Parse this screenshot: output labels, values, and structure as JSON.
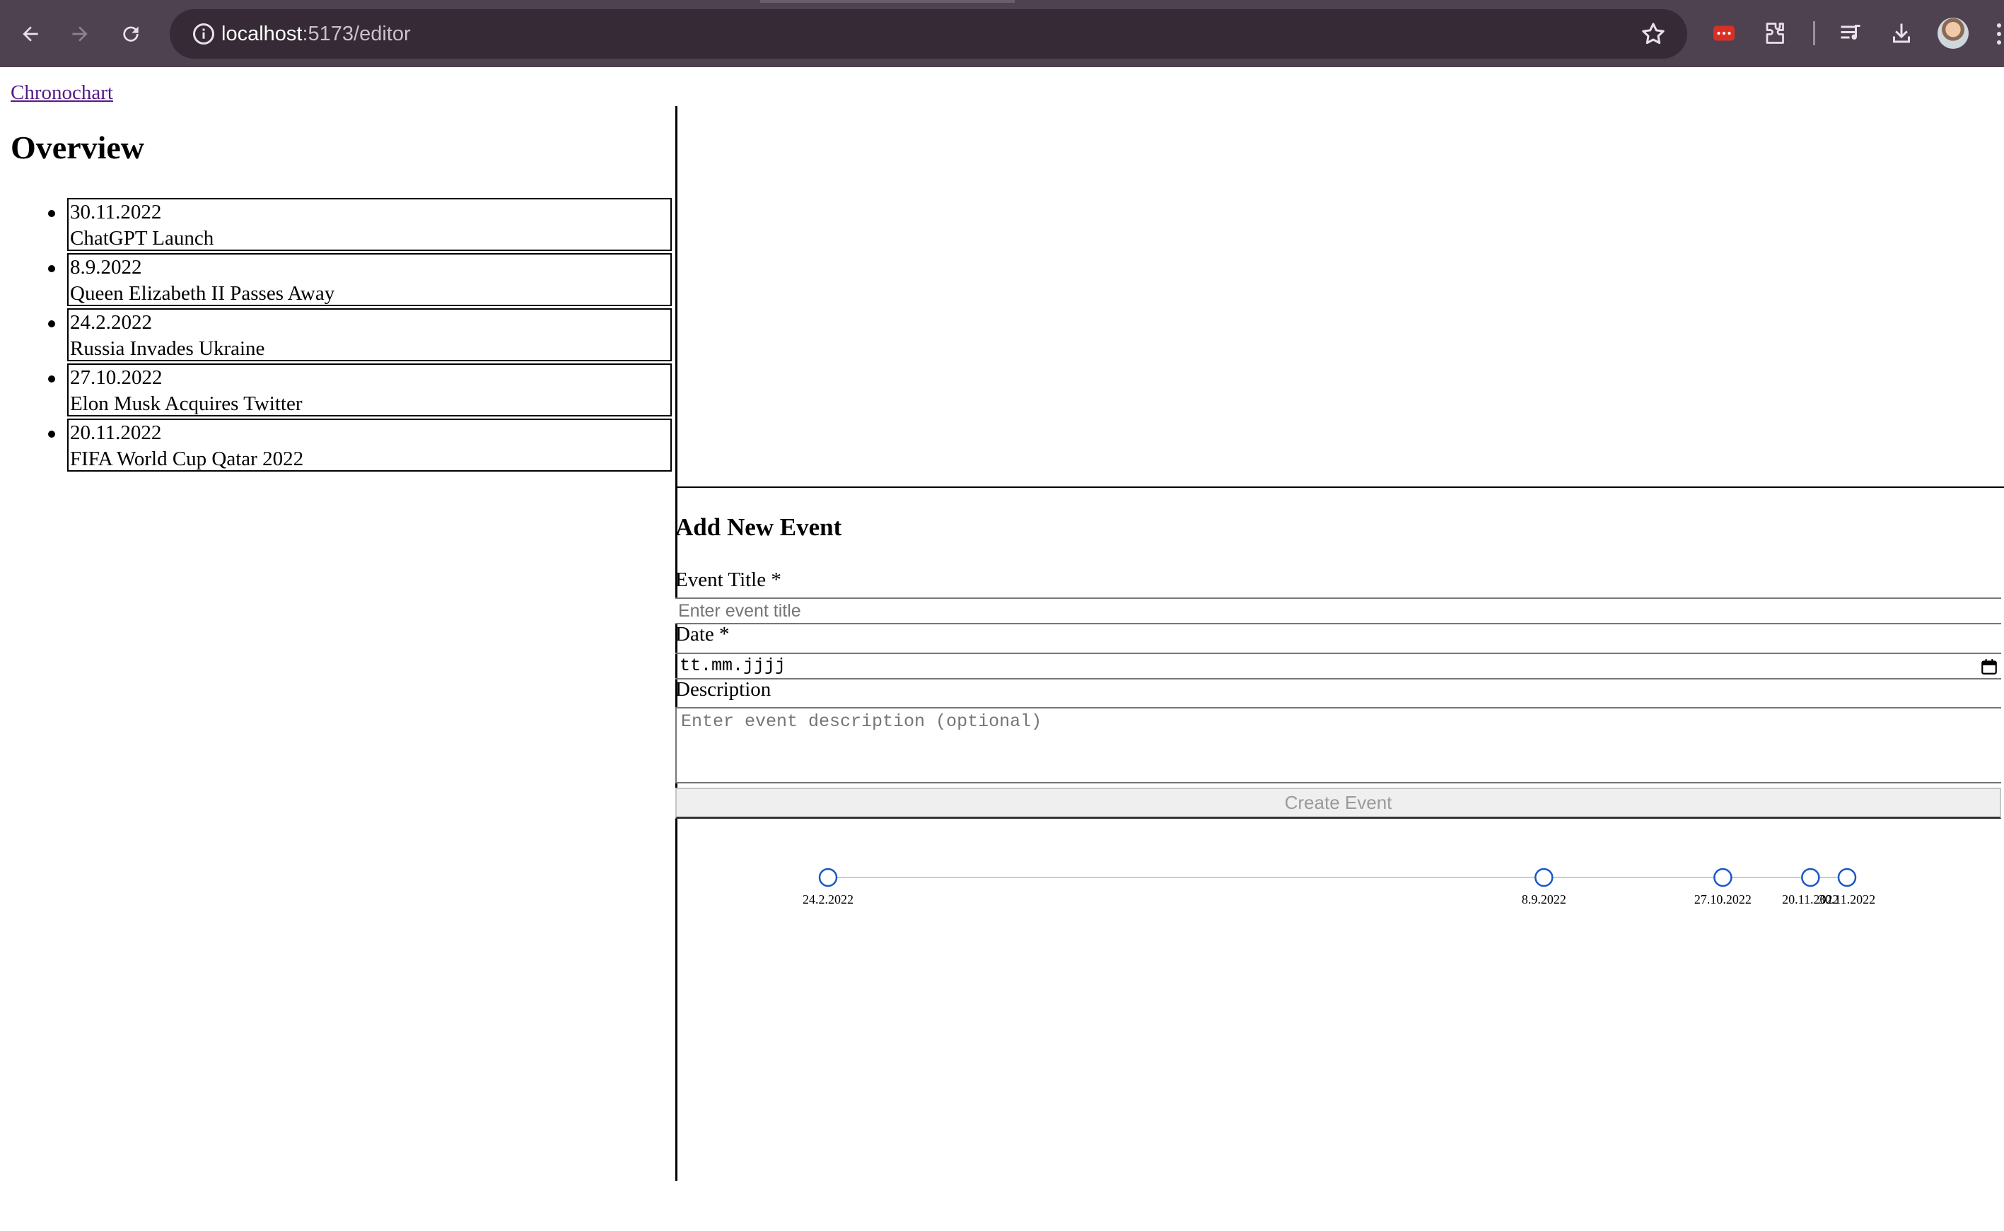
{
  "browser": {
    "url_host": "localhost",
    "url_path": ":5173/editor",
    "icons": [
      "back-arrow-icon",
      "forward-arrow-icon",
      "reload-icon",
      "site-info-icon",
      "bookmark-star-icon",
      "password-manager-icon",
      "extensions-puzzle-icon",
      "media-queue-icon",
      "download-icon",
      "profile-avatar",
      "more-menu-icon"
    ]
  },
  "nav": {
    "home_link": "Chronochart"
  },
  "overview": {
    "title": "Overview",
    "events": [
      {
        "date": "30.11.2022",
        "title": "ChatGPT Launch"
      },
      {
        "date": "8.9.2022",
        "title": "Queen Elizabeth II Passes Away"
      },
      {
        "date": "24.2.2022",
        "title": "Russia Invades Ukraine"
      },
      {
        "date": "27.10.2022",
        "title": "Elon Musk Acquires Twitter"
      },
      {
        "date": "20.11.2022",
        "title": "FIFA World Cup Qatar 2022"
      }
    ]
  },
  "form": {
    "title": "Add New Event",
    "title_label": "Event Title *",
    "title_placeholder": "Enter event title",
    "date_label": "Date *",
    "date_placeholder": "tt.mm.jjjj",
    "description_label": "Description",
    "description_placeholder": "Enter event description (optional)",
    "submit_label": "Create Event"
  },
  "chart_data": {
    "type": "scatter",
    "x": [
      "2022-02-24",
      "2022-09-08",
      "2022-10-27",
      "2022-11-20",
      "2022-11-30"
    ],
    "labels": [
      "24.2.2022",
      "8.9.2022",
      "27.10.2022",
      "20.11.2022",
      "30.11.2022"
    ],
    "marker_color": "#1a56c8",
    "axis_line_color": "#cccccc"
  }
}
